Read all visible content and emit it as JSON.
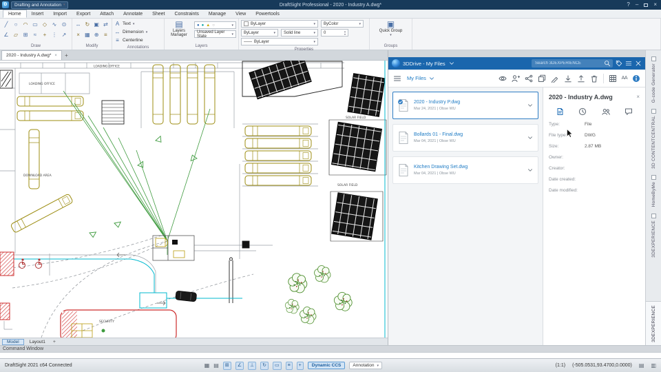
{
  "colors": {
    "titlebar": "#173a5a",
    "panel_header": "#1a66ad",
    "accent": "#1f6db5",
    "link": "#1e7bc4",
    "selected_border": "#2e7cc3",
    "status_chip_bg": "#d2e4f5",
    "status_chip_border": "#5b9bd5"
  },
  "title_bar": {
    "workspace": "Drafting and Annotation",
    "title": "DraftSight Professional - 2020 - Industry A.dwg*",
    "help": "?",
    "minimize": "–",
    "close": "×"
  },
  "menu": {
    "tabs": [
      "Home",
      "Insert",
      "Import",
      "Export",
      "Attach",
      "Annotate",
      "Sheet",
      "Constraints",
      "Manage",
      "View",
      "Powertools"
    ]
  },
  "ribbon": {
    "groups": [
      "Draw",
      "Modify",
      "Annotations",
      "Layers",
      "Properties",
      "Groups"
    ],
    "draw_glyphs_r1": [
      "╱",
      "○",
      "◠",
      "▭",
      "◇",
      "∿",
      "⊙"
    ],
    "draw_glyphs_r2": [
      "∠",
      "▱",
      "⊞",
      "≈",
      "+",
      "⋮",
      "↗"
    ],
    "modify_glyphs_r1": [
      "↔",
      "↻",
      "▣",
      "⇄"
    ],
    "modify_glyphs_r2": [
      "×",
      "▦",
      "⊕",
      "≡"
    ],
    "annotations": {
      "text": "Text",
      "text_glyph": "A",
      "dimension": "Dimension",
      "dim_glyph": "↔",
      "centerline": "Centerline",
      "center_glyph": "≡"
    },
    "layers": {
      "manager": "Layers Manager",
      "state": "Unsaved Layer State",
      "dots": [
        "●",
        "●",
        "▲",
        "○"
      ]
    },
    "properties": {
      "line_color": "ByLayer",
      "line_style_a": "ByLayer",
      "line_style_b": "Solid line",
      "line_weight": "ByLayer",
      "weight_glyph": "——",
      "hatch_color": "ByColor",
      "transparency": "0"
    },
    "groups_group": {
      "quick_group": "Quick Group",
      "glyph": "▣"
    }
  },
  "document_tabs": {
    "active": "2020 - Industry A.dwg*",
    "close": "×",
    "add": "+"
  },
  "drawing": {
    "labels": [
      {
        "text": "LOADING OFFICE"
      },
      {
        "text": "LOADING OFFICE"
      },
      {
        "text": "DOWNLOAD AREA"
      },
      {
        "text": "SOLAR FIELD"
      },
      {
        "text": "SOLAR FIELD"
      },
      {
        "text": "SECURITY"
      }
    ]
  },
  "drive_panel": {
    "title": "3DDrive - My Files",
    "search_placeholder": "Search 3DEXPERIENCE",
    "breadcrumb": "My Files",
    "aa_label": "AA",
    "files": [
      {
        "name": "2020 - Industry P.dwg",
        "meta": "Mar 24, 2021 | Obse WU"
      },
      {
        "name": "Bollards 01 - Final.dwg",
        "meta": "Mar 04, 2021 | Obse WU"
      },
      {
        "name": "Kitchen Drawing Set.dwg",
        "meta": "Mar 04, 2021 | Obse WU"
      }
    ]
  },
  "details_panel": {
    "title": "2020 - Industry A.dwg",
    "close": "×",
    "fields": [
      {
        "label": "Type:",
        "value": "File"
      },
      {
        "label": "File type:",
        "value": "DWG"
      },
      {
        "label": "Size:",
        "value": "2.87 MB"
      },
      {
        "label": "Owner:",
        "value": ""
      },
      {
        "label": "Creator:",
        "value": ""
      },
      {
        "label": "Date created:",
        "value": ""
      },
      {
        "label": "Date modified:",
        "value": ""
      }
    ]
  },
  "side_rail": {
    "items": [
      "G-code Generator",
      "3D CONTENTCENTRAL",
      "HomeByMe",
      "3DEXPERIENCE",
      "3DEXPERIENCE"
    ]
  },
  "sheet_tabs": {
    "model": "Model",
    "layout": "Layout1",
    "add": "+"
  },
  "command_window": {
    "label": "Command Window"
  },
  "status_bar": {
    "left": "DraftSight 2021 c64 Connected",
    "icons": [
      "▦",
      "▤"
    ],
    "toggles": [
      "⊞",
      "∠",
      "⊥",
      "↻",
      "▭",
      "≡",
      "+"
    ],
    "dynamic_ccs": "Dynamic CCS",
    "annotation": "Annotation",
    "scale": "(1:1)",
    "coords": "(-505.0531,93.4700,0.0000)",
    "right_icons": [
      "▤",
      "▥"
    ]
  }
}
